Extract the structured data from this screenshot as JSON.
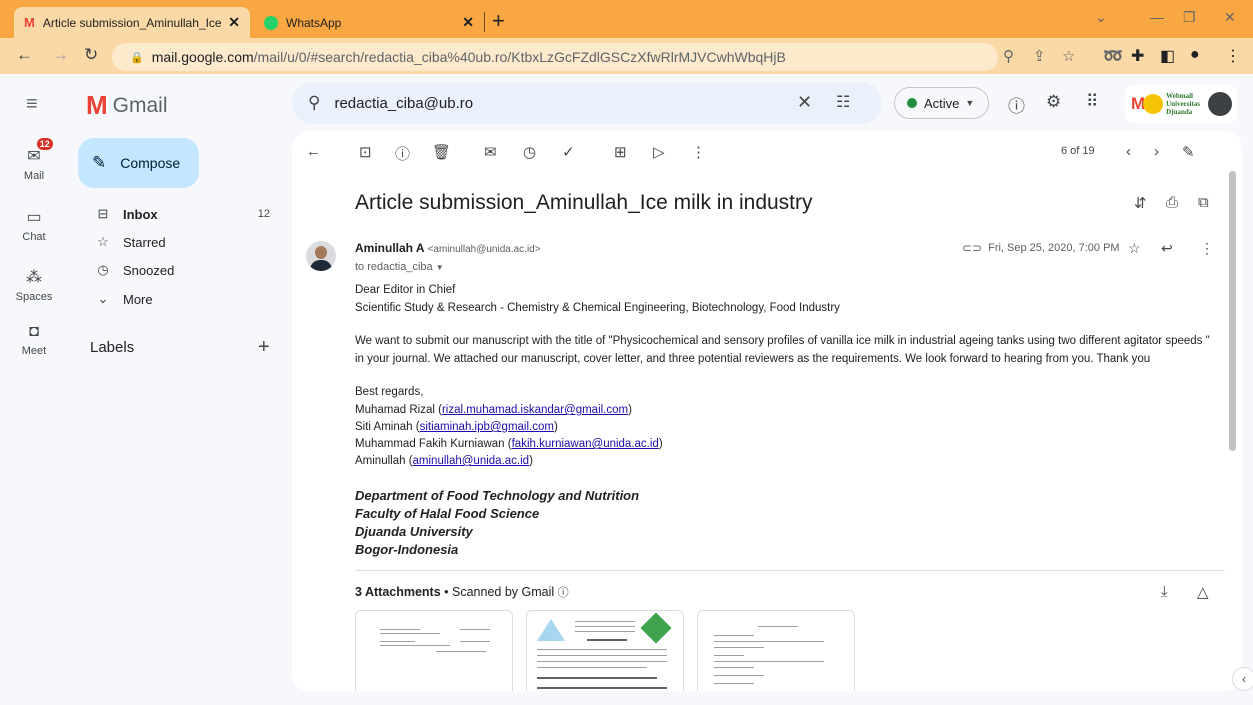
{
  "browser": {
    "tabs": [
      {
        "label": "Article submission_Aminullah_Ice",
        "icon": "gmail-icon",
        "active": true
      },
      {
        "label": "WhatsApp",
        "icon": "whatsapp-icon",
        "active": false
      }
    ],
    "url_host": "mail.google.com",
    "url_path": "/mail/u/0/#search/redactia_ciba%40ub.ro/KtbxLzGcFZdlGSCzXfwRlrMJVCwhWbqHjB"
  },
  "gmail": {
    "product_name": "Gmail",
    "rail": [
      {
        "label": "Mail",
        "icon": "mail-icon",
        "badge": "12"
      },
      {
        "label": "Chat",
        "icon": "chat-icon"
      },
      {
        "label": "Spaces",
        "icon": "spaces-icon"
      },
      {
        "label": "Meet",
        "icon": "meet-icon"
      }
    ],
    "compose_label": "Compose",
    "nav": [
      {
        "label": "Inbox",
        "icon": "inbox-icon",
        "count": "12"
      },
      {
        "label": "Starred",
        "icon": "star-icon",
        "count": ""
      },
      {
        "label": "Snoozed",
        "icon": "clock-icon",
        "count": ""
      },
      {
        "label": "More",
        "icon": "chevron-down-icon",
        "count": ""
      }
    ],
    "labels_heading": "Labels",
    "search_value": "redactia_ciba@ub.ro",
    "status": "Active",
    "brand": {
      "letter": "M",
      "text_line1": "Webmail",
      "text_line2": "Universitas",
      "text_line3": "Djuanda"
    }
  },
  "message": {
    "counter": "6 of 19",
    "subject": "Article submission_Aminullah_Ice milk in industry",
    "sender_name": "Aminullah A",
    "sender_email": "<aminullah@unida.ac.id>",
    "to_line": "to redactia_ciba",
    "date": "Fri, Sep 25, 2020, 7:00 PM",
    "greeting": "Dear Editor in Chief",
    "journal": "Scientific Study & Research - Chemistry & Chemical Engineering, Biotechnology, Food Industry",
    "para1_line1": "We want to submit our manuscript with the title of \"Physicochemical and sensory profiles of vanilla ice milk in industrial ageing tanks using two different agitator speeds \"",
    "para1_line2": "in your journal. We attached our manuscript, cover letter, and three potential reviewers as the requirements. We look forward to hearing from you. Thank you",
    "regards": "Best regards,",
    "authors": [
      {
        "name": "Muhamad Rizal",
        "email": "rizal.muhamad.iskandar@gmail.com"
      },
      {
        "name": "Siti Aminah",
        "email": "sitiaminah.ipb@gmail.com"
      },
      {
        "name": "Muhammad Fakih Kurniawan",
        "email": "fakih.kurniawan@unida.ac.id"
      },
      {
        "name": "Aminullah",
        "email": "aminullah@unida.ac.id"
      }
    ],
    "signature": [
      "Department of Food Technology and Nutrition",
      "Faculty of Halal Food Science",
      "Djuanda University",
      "Bogor-Indonesia"
    ],
    "attachments_count_label": "3 Attachments",
    "scanned_label": "Scanned by Gmail"
  }
}
